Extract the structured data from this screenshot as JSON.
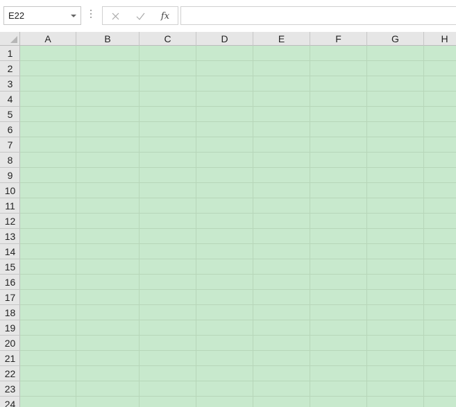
{
  "formula_bar": {
    "name_box": "E22",
    "cancel_icon": "close-icon",
    "enter_icon": "check-icon",
    "function_label": "fx",
    "formula_value": ""
  },
  "sheet": {
    "columns": [
      "A",
      "B",
      "C",
      "D",
      "E",
      "F",
      "G",
      "H"
    ],
    "rows": [
      "1",
      "2",
      "3",
      "4",
      "5",
      "6",
      "7",
      "8",
      "9",
      "10",
      "11",
      "12",
      "13",
      "14",
      "15",
      "16",
      "17",
      "18",
      "19",
      "20",
      "21",
      "22",
      "23",
      "24"
    ],
    "cell_fill": "#c8e9cd",
    "header_fill": "#e6e6e6",
    "gridline_color": "#b7d6b9"
  }
}
